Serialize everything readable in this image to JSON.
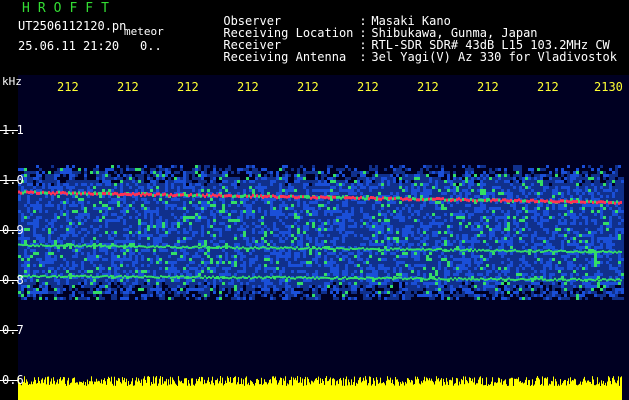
{
  "header": {
    "logo": "HROFFT",
    "filename": "UT2506112120.pn",
    "meteor_label": "meteor",
    "date_time": "25.06.11 21:20",
    "extra": "0..",
    "info": [
      {
        "label": "Observer",
        "value": "Masaki Kano"
      },
      {
        "label": "Receiving Location",
        "value": "Shibukawa, Gunma, Japan"
      },
      {
        "label": "Receiver",
        "value": "RTL-SDR SDR# 43dB L15 103.2MHz CW"
      },
      {
        "label": "Receiving Antenna",
        "value": "3el Yagi(V) Az 330 for Vladivostok"
      }
    ]
  },
  "spectrogram": {
    "unit": "kHz",
    "time_ticks": [
      "212",
      "212",
      "212",
      "212",
      "212",
      "212",
      "212",
      "212",
      "212",
      "2130"
    ],
    "freq_labels": [
      "1.1",
      "1.0",
      "0.9",
      "0.8",
      "0.7",
      "0.6"
    ],
    "colors": {
      "background": "#000020",
      "noise": "#1a4fd8",
      "signal_strong": "#ff3355",
      "signal_mid": "#33dd66",
      "amplitude": "#ffff00"
    }
  }
}
